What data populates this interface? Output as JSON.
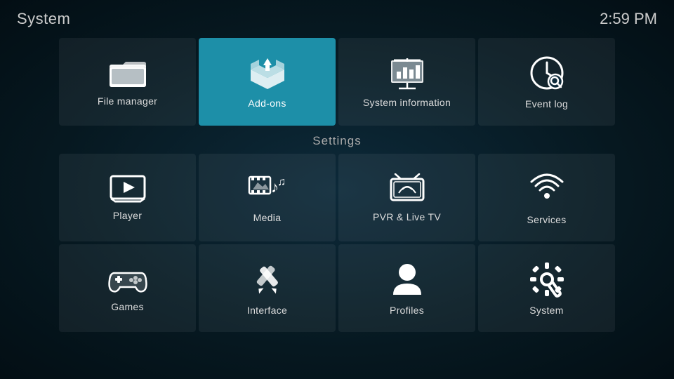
{
  "header": {
    "title": "System",
    "time": "2:59 PM"
  },
  "top_row": [
    {
      "id": "file-manager",
      "label": "File manager",
      "active": false
    },
    {
      "id": "add-ons",
      "label": "Add-ons",
      "active": true
    },
    {
      "id": "system-information",
      "label": "System information",
      "active": false
    },
    {
      "id": "event-log",
      "label": "Event log",
      "active": false
    }
  ],
  "settings_label": "Settings",
  "settings_row1": [
    {
      "id": "player",
      "label": "Player"
    },
    {
      "id": "media",
      "label": "Media"
    },
    {
      "id": "pvr-live-tv",
      "label": "PVR & Live TV"
    },
    {
      "id": "services",
      "label": "Services"
    }
  ],
  "settings_row2": [
    {
      "id": "games",
      "label": "Games"
    },
    {
      "id": "interface",
      "label": "Interface"
    },
    {
      "id": "profiles",
      "label": "Profiles"
    },
    {
      "id": "system",
      "label": "System"
    }
  ]
}
